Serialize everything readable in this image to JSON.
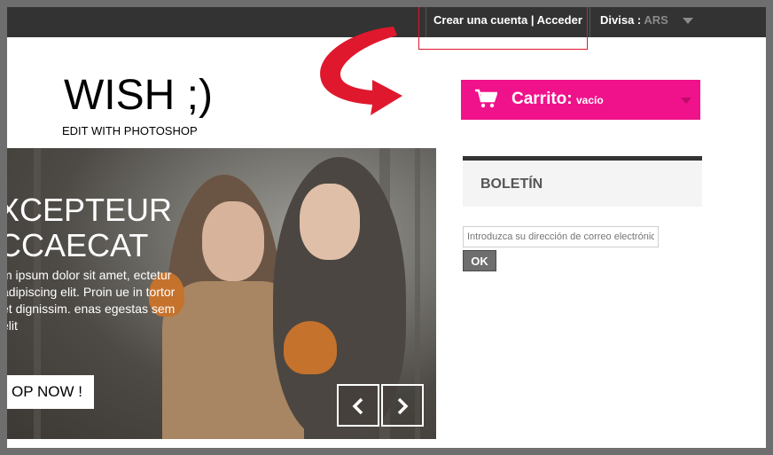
{
  "topbar": {
    "account_link": "Crear una cuenta | Acceder",
    "currency_label": "Divisa :",
    "currency_value": "ARS"
  },
  "logo": {
    "title": "WISH ;)",
    "subtitle": "EDIT WITH PHOTOSHOP"
  },
  "cart": {
    "label": "Carrito:",
    "value": "vacío",
    "icon": "shopping-cart-icon"
  },
  "slider": {
    "heading_line1": "XCEPTEUR",
    "heading_line2": "CCAECAT",
    "text": "m ipsum dolor sit amet, ectetur adipiscing elit. Proin ue in tortor et dignissim. enas egestas sem elit",
    "button": "OP NOW !"
  },
  "newsletter": {
    "title": "BOLETÍN",
    "placeholder": "Introduzca su dirección de correo electrónico",
    "submit": "OK"
  },
  "colors": {
    "topbar": "#333333",
    "cart": "#f0128a",
    "arrow": "#e0182d"
  }
}
